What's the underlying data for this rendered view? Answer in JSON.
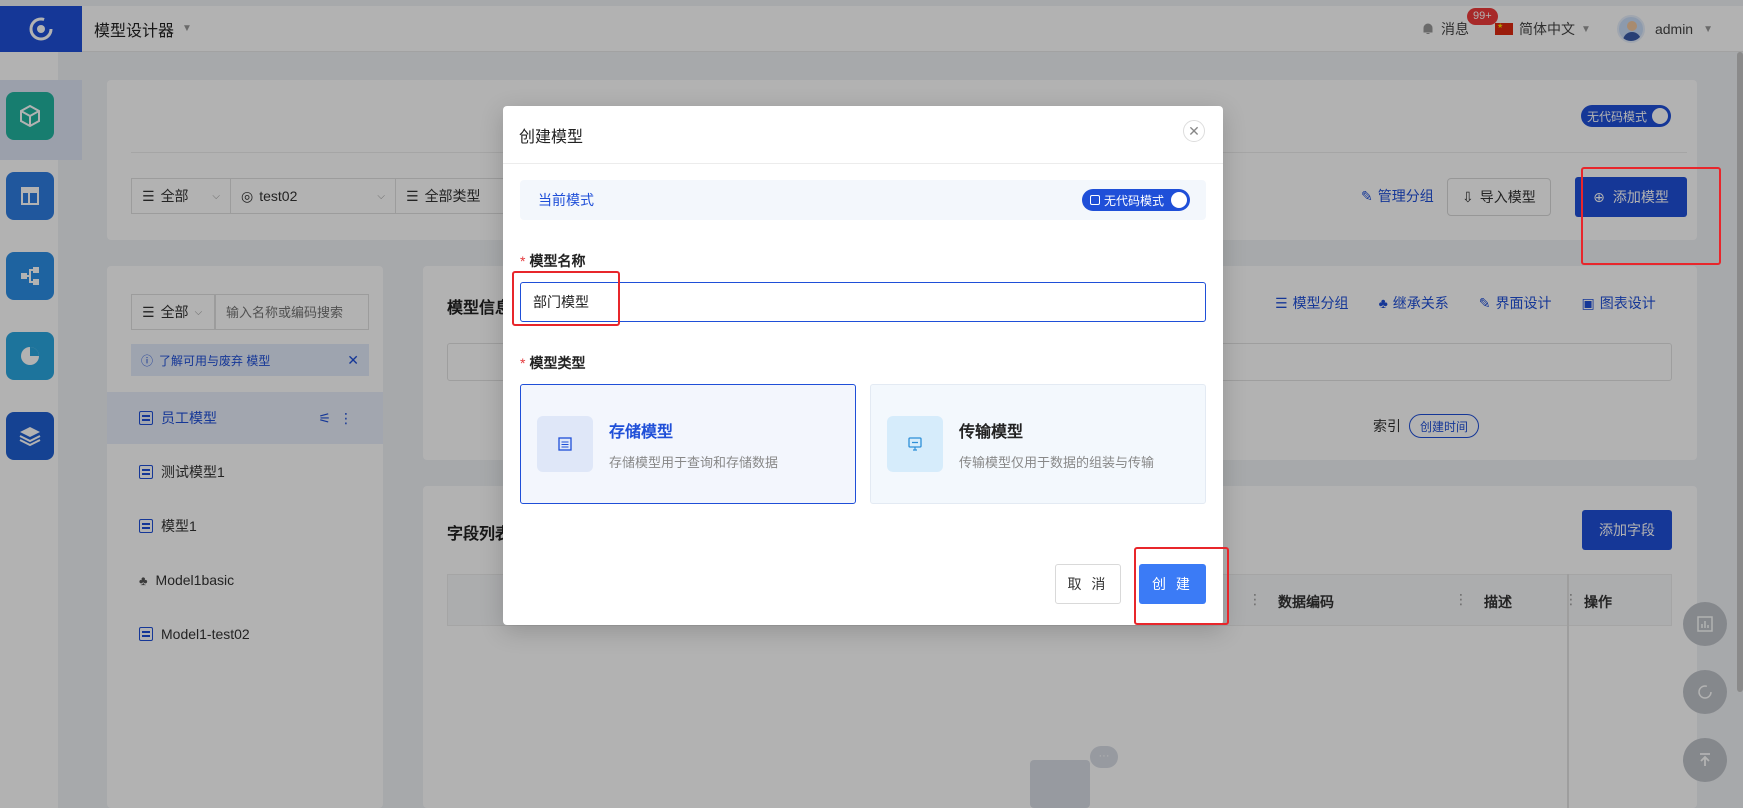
{
  "app": {
    "title": "模型设计器",
    "messages_label": "消息",
    "messages_badge": "99+",
    "language": "简体中文",
    "user": "admin"
  },
  "toolbar": {
    "no_code_toggle": "无代码模式",
    "filter_all": "全部",
    "filter_app": "test02",
    "filter_type": "全部类型",
    "manage_groups": "管理分组",
    "import_model": "导入模型",
    "add_model": "添加模型"
  },
  "sidebar": {
    "filter_all": "全部",
    "search_placeholder": "输入名称或编码搜索",
    "notice": "了解可用与废弃 模型",
    "items": [
      {
        "label": "员工模型",
        "icon": "table-icon"
      },
      {
        "label": "测试模型1",
        "icon": "table-icon"
      },
      {
        "label": "模型1",
        "icon": "table-icon"
      },
      {
        "label": "Model1basic",
        "icon": "hierarchy-icon"
      },
      {
        "label": "Model1-test02",
        "icon": "table-icon"
      }
    ]
  },
  "model_info": {
    "title": "模型信息",
    "links": [
      "模型分组",
      "继承关系",
      "界面设计",
      "图表设计"
    ],
    "index_label": "索引",
    "index_tag": "创建时间"
  },
  "field_list": {
    "title": "字段列表",
    "add_field": "添加字段",
    "columns": [
      "数据编码",
      "描述",
      "操作"
    ]
  },
  "modal": {
    "title": "创建模型",
    "current_mode_label": "当前模式",
    "mode_toggle": "无代码模式",
    "name_label": "模型名称",
    "name_value": "部门模型",
    "type_label": "模型类型",
    "types": [
      {
        "title": "存储模型",
        "desc": "存储模型用于查询和存储数据"
      },
      {
        "title": "传输模型",
        "desc": "传输模型仅用于数据的组装与传输"
      }
    ],
    "cancel": "取 消",
    "create": "创 建"
  },
  "colors": {
    "primary": "#1f4fd8",
    "create_button": "#3b7bf6",
    "highlight": "#e8262b",
    "badge": "#ef3b3b"
  }
}
